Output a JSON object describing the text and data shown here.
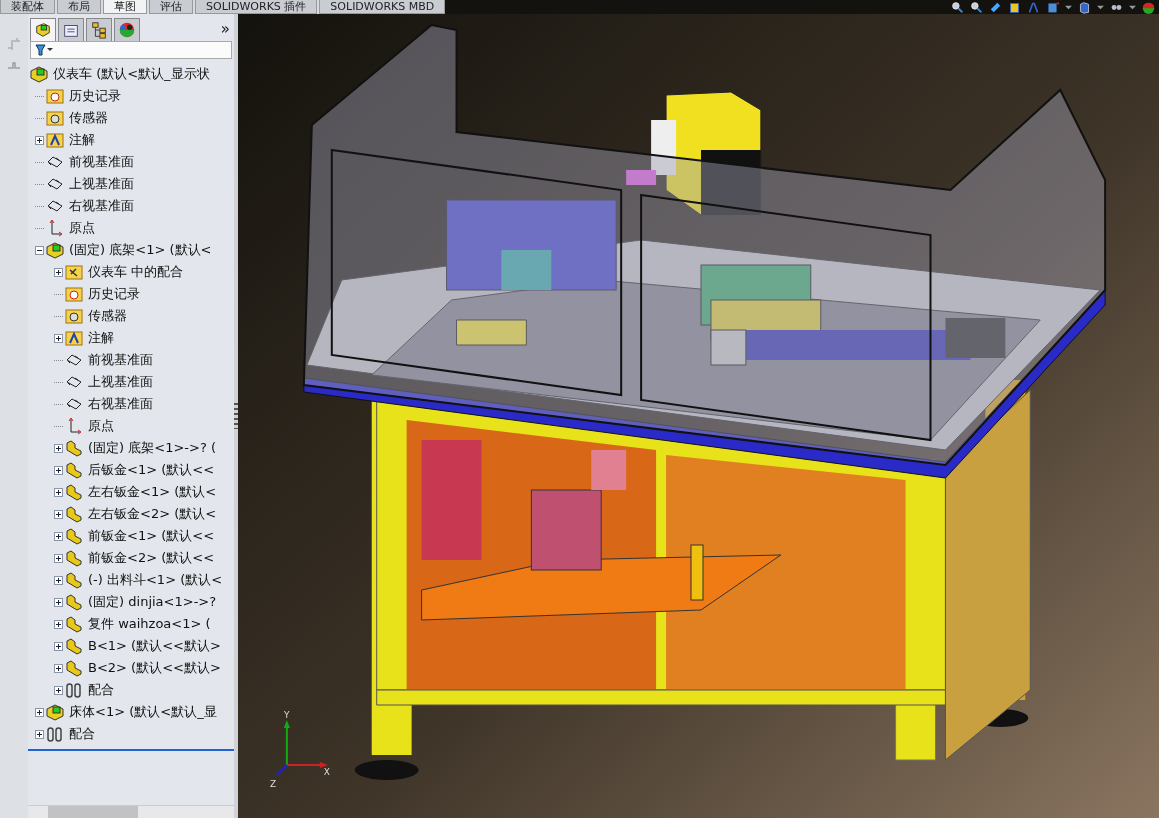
{
  "ribbon_tabs": [
    {
      "label": "装配体",
      "selected": false
    },
    {
      "label": "布局",
      "selected": false
    },
    {
      "label": "草图",
      "selected": true
    },
    {
      "label": "评估",
      "selected": false
    },
    {
      "label": "SOLIDWORKS 插件",
      "selected": false
    },
    {
      "label": "SOLIDWORKS MBD",
      "selected": false
    }
  ],
  "panel": {
    "more": "»"
  },
  "tree": [
    {
      "label": "仪表车 (默认<默认_显示状",
      "kind": "assembly",
      "children": [
        {
          "label": "历史记录",
          "kind": "history"
        },
        {
          "label": "传感器",
          "kind": "sensor"
        },
        {
          "label": "注解",
          "kind": "annotation",
          "expanded": false
        },
        {
          "label": "前视基准面",
          "kind": "plane"
        },
        {
          "label": "上视基准面",
          "kind": "plane"
        },
        {
          "label": "右视基准面",
          "kind": "plane"
        },
        {
          "label": "原点",
          "kind": "origin"
        },
        {
          "label": "(固定) 底架<1> (默认<",
          "kind": "assembly",
          "expanded": true,
          "children": [
            {
              "label": "仪表车 中的配合",
              "kind": "mates-folder",
              "expanded": false
            },
            {
              "label": "历史记录",
              "kind": "history"
            },
            {
              "label": "传感器",
              "kind": "sensor"
            },
            {
              "label": "注解",
              "kind": "annotation",
              "expanded": false
            },
            {
              "label": "前视基准面",
              "kind": "plane"
            },
            {
              "label": "上视基准面",
              "kind": "plane"
            },
            {
              "label": "右视基准面",
              "kind": "plane"
            },
            {
              "label": "原点",
              "kind": "origin"
            },
            {
              "label": "(固定) 底架<1>->? (",
              "kind": "part",
              "expanded": false
            },
            {
              "label": "后钣金<1> (默认<<",
              "kind": "part",
              "expanded": false
            },
            {
              "label": "左右钣金<1> (默认<",
              "kind": "part",
              "expanded": false
            },
            {
              "label": "左右钣金<2> (默认<",
              "kind": "part",
              "expanded": false
            },
            {
              "label": "前钣金<1> (默认<<",
              "kind": "part",
              "expanded": false
            },
            {
              "label": "前钣金<2> (默认<<",
              "kind": "part",
              "expanded": false
            },
            {
              "label": "(-) 出料斗<1> (默认<",
              "kind": "part",
              "expanded": false
            },
            {
              "label": "(固定) dinjia<1>->?",
              "kind": "part",
              "expanded": false
            },
            {
              "label": "复件 waihzoa<1> (",
              "kind": "part",
              "expanded": false
            },
            {
              "label": "B<1> (默认<<默认>",
              "kind": "part",
              "expanded": false
            },
            {
              "label": "B<2> (默认<<默认>",
              "kind": "part",
              "expanded": false
            },
            {
              "label": "配合",
              "kind": "mates",
              "expanded": false
            }
          ]
        },
        {
          "label": "床体<1> (默认<默认_显",
          "kind": "assembly",
          "expanded": false
        },
        {
          "label": "配合",
          "kind": "mates",
          "expanded": false
        }
      ]
    }
  ],
  "triad": {
    "x": "X",
    "y": "Y",
    "z": "Z"
  }
}
